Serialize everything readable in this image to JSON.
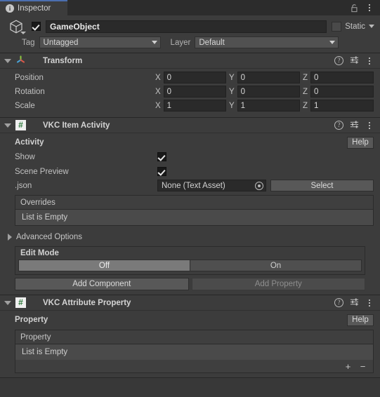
{
  "window": {
    "tab_label": "Inspector",
    "info_icon": "info-icon",
    "lock_icon": "lock-icon",
    "menu_icon": "kebab-menu-icon"
  },
  "gameobject": {
    "icon": "cube-icon",
    "enabled": true,
    "name": "GameObject",
    "static_label": "Static",
    "static_checked": false,
    "tag_label": "Tag",
    "tag_value": "Untagged",
    "layer_label": "Layer",
    "layer_value": "Default"
  },
  "transform": {
    "icon": "transform-axis-icon",
    "title": "Transform",
    "expanded": true,
    "rows": [
      {
        "label": "Position",
        "x": "0",
        "y": "0",
        "z": "0"
      },
      {
        "label": "Rotation",
        "x": "0",
        "y": "0",
        "z": "0"
      },
      {
        "label": "Scale",
        "x": "1",
        "y": "1",
        "z": "1"
      }
    ],
    "axes": {
      "x": "X",
      "y": "Y",
      "z": "Z"
    }
  },
  "item_activity": {
    "icon": "script-icon",
    "title": "VKC Item Activity",
    "expanded": true,
    "section_title": "Activity",
    "help_label": "Help",
    "show_label": "Show",
    "show_checked": true,
    "scene_preview_label": "Scene Preview",
    "scene_preview_checked": true,
    "json_label": ".json",
    "json_value": "None (Text Asset)",
    "json_picker_icon": "object-picker-icon",
    "select_label": "Select",
    "overrides_header": "Overrides",
    "overrides_empty": "List is Empty",
    "advanced_options_label": "Advanced Options",
    "advanced_expanded": false,
    "edit_mode_label": "Edit Mode",
    "edit_mode_off": "Off",
    "edit_mode_on": "On",
    "edit_mode_selected": "Off",
    "add_component_label": "Add Component",
    "add_property_label": "Add Property",
    "add_property_disabled": true
  },
  "attribute_property": {
    "icon": "script-icon",
    "title": "VKC Attribute Property",
    "expanded": true,
    "section_title": "Property",
    "help_label": "Help",
    "list_header": "Property",
    "list_empty": "List is Empty",
    "add_label": "+",
    "remove_label": "−"
  },
  "colors": {
    "panel": "#3c3c3c",
    "background": "#383838",
    "tab_accent": "#4b6eaf",
    "field": "#2a2a2a",
    "button": "#585858",
    "script_green": "#2f7a3c"
  }
}
